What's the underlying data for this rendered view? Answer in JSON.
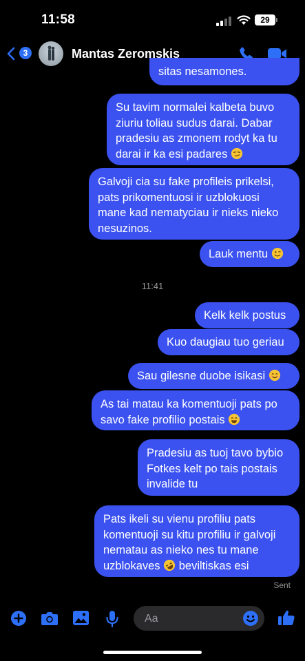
{
  "status_bar": {
    "time": "11:58",
    "battery": "29"
  },
  "header": {
    "back_count": "3",
    "contact_name": "Mantas Zeromskis"
  },
  "messages": [
    {
      "text": "sitas nesamones."
    },
    {
      "text": "Su tavim normalei kalbeta buvo\nziuriu toliau sudus darai. Dabar\npradesiu as zmonem rodyt ka tu\ndarai ir ka esi padares",
      "emoji": "smirk"
    },
    {
      "text": "Galvoji cia su fake profileis prikelsi,\npats prikomentuosi ir uzblokuosi\nmane kad nematyciau ir nieks nieko\nnesuzinos."
    },
    {
      "text": "Lauk mentu",
      "emoji": "wink"
    },
    {
      "text": "Kelk kelk postus"
    },
    {
      "text": "Kuo daugiau tuo geriau"
    },
    {
      "text": "Sau gilesne duobe isikasi",
      "emoji": "smile"
    },
    {
      "text": "As tai matau ka komentuoji pats po\nsavo fake profilio postais",
      "emoji": "sweat-smile"
    },
    {
      "text": "Pradesiu as tuoj tavo bybio\nFotkes kelt po tais postais\ninvalide tu"
    },
    {
      "text": "Pats ikeli su vienu profiliu pats\nkomentuoji su kitu profiliu ir galvoji\nnematau as nieko nes tu mane\nuzblokaves",
      "emoji": "rofl",
      "suffix": " beviltiskas esi"
    }
  ],
  "timestamp": "11:41",
  "sent_label": "Sent",
  "composer": {
    "placeholder": "Aa"
  },
  "colors": {
    "bubble": "#3b52f0",
    "accent": "#2d6ff7",
    "background": "#000000"
  }
}
